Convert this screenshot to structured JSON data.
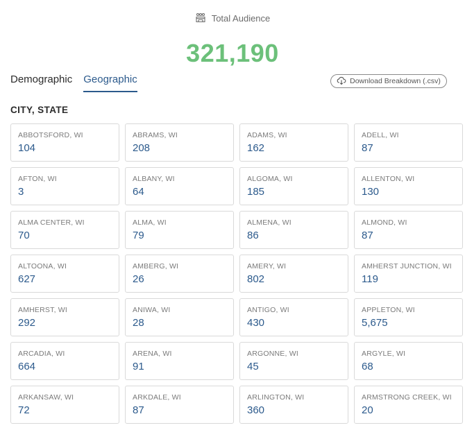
{
  "header": {
    "label": "Total Audience",
    "icon": "audience-icon"
  },
  "total": "321,190",
  "tabs": [
    {
      "label": "Demographic",
      "active": false
    },
    {
      "label": "Geographic",
      "active": true
    }
  ],
  "download": {
    "label": "Download Breakdown (.csv)",
    "icon": "cloud-download-icon"
  },
  "section_title": "CITY, STATE",
  "cities": [
    {
      "name": "ABBOTSFORD, WI",
      "count": "104"
    },
    {
      "name": "ABRAMS, WI",
      "count": "208"
    },
    {
      "name": "ADAMS, WI",
      "count": "162"
    },
    {
      "name": "ADELL, WI",
      "count": "87"
    },
    {
      "name": "AFTON, WI",
      "count": "3"
    },
    {
      "name": "ALBANY, WI",
      "count": "64"
    },
    {
      "name": "ALGOMA, WI",
      "count": "185"
    },
    {
      "name": "ALLENTON, WI",
      "count": "130"
    },
    {
      "name": "ALMA CENTER, WI",
      "count": "70"
    },
    {
      "name": "ALMA, WI",
      "count": "79"
    },
    {
      "name": "ALMENA, WI",
      "count": "86"
    },
    {
      "name": "ALMOND, WI",
      "count": "87"
    },
    {
      "name": "ALTOONA, WI",
      "count": "627"
    },
    {
      "name": "AMBERG, WI",
      "count": "26"
    },
    {
      "name": "AMERY, WI",
      "count": "802"
    },
    {
      "name": "AMHERST JUNCTION, WI",
      "count": "119"
    },
    {
      "name": "AMHERST, WI",
      "count": "292"
    },
    {
      "name": "ANIWA, WI",
      "count": "28"
    },
    {
      "name": "ANTIGO, WI",
      "count": "430"
    },
    {
      "name": "APPLETON, WI",
      "count": "5,675"
    },
    {
      "name": "ARCADIA, WI",
      "count": "664"
    },
    {
      "name": "ARENA, WI",
      "count": "91"
    },
    {
      "name": "ARGONNE, WI",
      "count": "45"
    },
    {
      "name": "ARGYLE, WI",
      "count": "68"
    },
    {
      "name": "ARKANSAW, WI",
      "count": "72"
    },
    {
      "name": "ARKDALE, WI",
      "count": "87"
    },
    {
      "name": "ARLINGTON, WI",
      "count": "360"
    },
    {
      "name": "ARMSTRONG CREEK, WI",
      "count": "20"
    }
  ],
  "colors": {
    "accent_green": "#6cc07a",
    "link_blue": "#2c5a8c"
  }
}
